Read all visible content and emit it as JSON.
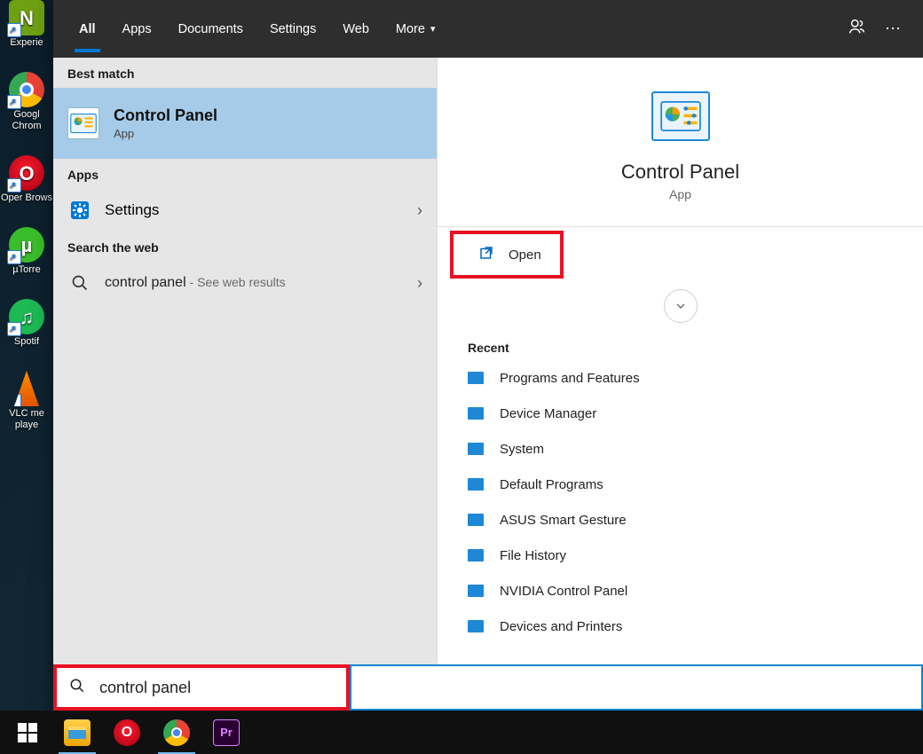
{
  "desktop_icons": [
    {
      "label": "Experie"
    },
    {
      "label": "Googl\nChrom"
    },
    {
      "label": "Oper\nBrows"
    },
    {
      "label": "µTorre"
    },
    {
      "label": "Spotif"
    },
    {
      "label": "VLC me\nplaye"
    }
  ],
  "tabs": {
    "all": "All",
    "apps": "Apps",
    "documents": "Documents",
    "settings": "Settings",
    "web": "Web",
    "more": "More"
  },
  "left": {
    "best_match": "Best match",
    "result_title": "Control Panel",
    "result_sub": "App",
    "apps_header": "Apps",
    "settings_label": "Settings",
    "web_header": "Search the web",
    "web_query": "control panel",
    "web_hint": " - See web results"
  },
  "detail": {
    "title": "Control Panel",
    "sub": "App",
    "open": "Open",
    "recent_header": "Recent",
    "recent": [
      "Programs and Features",
      "Device Manager",
      "System",
      "Default Programs",
      "ASUS Smart Gesture",
      "File History",
      "NVIDIA Control Panel",
      "Devices and Printers"
    ]
  },
  "search_value": "control panel"
}
